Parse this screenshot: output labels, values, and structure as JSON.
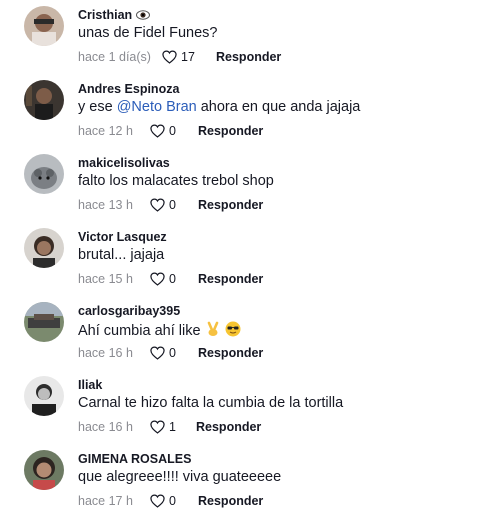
{
  "comments": [
    {
      "username": "Cristhian",
      "text": "unas de Fidel Funes?",
      "time": "hace 1 día(s)",
      "likes": "17",
      "reply_label": "Responder"
    },
    {
      "username": "Andres Espinoza",
      "text_pre": "y ese ",
      "mention": "@Neto Bran",
      "text_post": " ahora en que anda jajaja",
      "time": "hace 12 h",
      "likes": "0",
      "reply_label": "Responder"
    },
    {
      "username": "makicelisolivas",
      "text": "falto los malacates trebol shop",
      "time": "hace 13 h",
      "likes": "0",
      "reply_label": "Responder"
    },
    {
      "username": "Victor Lasquez",
      "text": "brutal... jajaja",
      "time": "hace 15 h",
      "likes": "0",
      "reply_label": "Responder"
    },
    {
      "username": "carlosgaribay395",
      "text": "Ahí cumbia ahí like",
      "time": "hace 16 h",
      "likes": "0",
      "reply_label": "Responder"
    },
    {
      "username": "Iliak",
      "text": "Carnal te hizo falta la cumbia de la tortilla",
      "time": "hace 16 h",
      "likes": "1",
      "reply_label": "Responder"
    },
    {
      "username": "GIMENA ROSALES",
      "text": "que alegreee!!!! viva guateeeee",
      "time": "hace 17 h",
      "likes": "0",
      "reply_label": "Responder"
    }
  ],
  "icons": {
    "like": "heart-outline-icon",
    "badge": "eye-icon"
  },
  "colors": {
    "mention": "#2b5db9",
    "meta": "#8a8b91",
    "text": "#161823"
  }
}
